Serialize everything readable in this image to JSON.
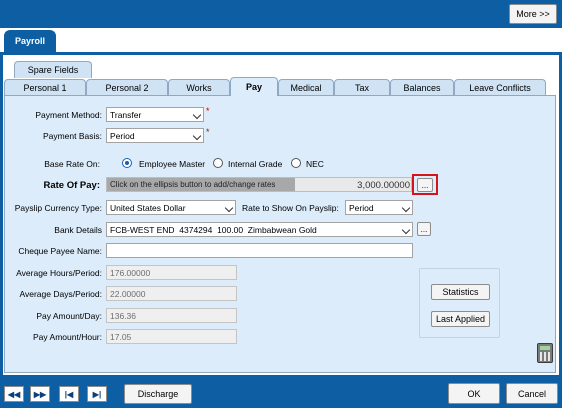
{
  "header": {
    "more_button": "More >>"
  },
  "main_tab": "Payroll",
  "tabs_row1": [
    "Spare Fields"
  ],
  "tabs_row2": [
    "Personal 1",
    "Personal 2",
    "Works",
    "Pay",
    "Medical",
    "Tax",
    "Balances",
    "Leave Conflicts"
  ],
  "active_tab": "Pay",
  "form": {
    "payment_method": {
      "label": "Payment Method:",
      "value": "Transfer"
    },
    "payment_basis": {
      "label": "Payment Basis:",
      "value": "Period"
    },
    "base_rate_on": {
      "label": "Base Rate On:",
      "options": [
        "Employee Master",
        "Internal Grade",
        "NEC"
      ],
      "selected": "Employee Master"
    },
    "rate_of_pay": {
      "label": "Rate Of Pay:",
      "hint": "Click on the ellipsis button to add/change rates",
      "value": "3,000.00000",
      "ellipsis": "..."
    },
    "payslip_currency": {
      "label": "Payslip Currency Type:",
      "value": "United States Dollar"
    },
    "rate_on_payslip": {
      "label": "Rate to Show On Payslip:",
      "value": "Period"
    },
    "bank_details": {
      "label": "Bank Details",
      "value": "FCB-WEST END  4374294  100.00  Zimbabwean Gold",
      "ellipsis": "..."
    },
    "cheque_payee": {
      "label": "Cheque Payee Name:",
      "value": ""
    },
    "avg_hours": {
      "label": "Average Hours/Period:",
      "value": "176.00000"
    },
    "avg_days": {
      "label": "Average Days/Period:",
      "value": "22.00000"
    },
    "pay_day": {
      "label": "Pay Amount/Day:",
      "value": "136.36"
    },
    "pay_hour": {
      "label": "Pay Amount/Hour:",
      "value": "17.05"
    },
    "required_mark": "*"
  },
  "side_buttons": {
    "statistics": "Statistics",
    "last_applied": "Last Applied"
  },
  "footer": {
    "nav": [
      "◀◀",
      "▶▶",
      "|◀",
      "▶|"
    ],
    "discharge": "Discharge",
    "ok": "OK",
    "cancel": "Cancel"
  }
}
